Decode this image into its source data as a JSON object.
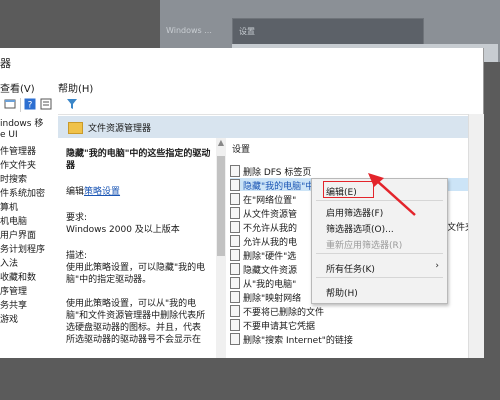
{
  "background_window": {
    "tree_item": "Windows ...",
    "header_text": "设置"
  },
  "window": {
    "title_partial": "器",
    "menu": {
      "view": "查看(V)",
      "help": "帮助(H)"
    }
  },
  "tree": [
    "indows 移",
    "e UI",
    "件管理器",
    "作文件夹",
    "时搜索",
    "件系统加密",
    "算机",
    "机电脑",
    "用户界面",
    "务计划程序",
    "入法",
    "收藏和数",
    "序管理",
    "务共享",
    "游戏"
  ],
  "header": {
    "title": "文件资源管理器"
  },
  "description": {
    "title_line1": "隐藏\"我的电脑\"中的这些指定的驱动",
    "title_line2": "器",
    "edit_prefix": "编辑",
    "edit_link": "策略设置",
    "req_label": "要求:",
    "req_value": "Windows 2000 及以上版本",
    "desc_label": "描述:",
    "desc_line1": "使用此策略设置，可以隐藏\"我的电",
    "desc_line2": "脑\"中的指定驱动器。",
    "desc_line3": "使用此策略设置，可以从\"我的电",
    "desc_line4": "脑\"和文件资源管理器中删除代表所",
    "desc_line5": "选硬盘驱动器的图标。并且，代表",
    "desc_line6": "所选驱动器的驱动器号不会显示在"
  },
  "list": {
    "column_header": "设置",
    "items": [
      "删除 DFS 标签页",
      "隐藏\"我的电脑\"中的这些指定的驱动器",
      "在\"网络位置\"",
      "从文件资源管",
      "不允许从我的",
      "允许从我的电",
      "删除\"硬件\"选",
      "隐藏文件资源",
      "从\"我的电脑\"",
      "删除\"映射网络",
      "不要将已删除的文件",
      "不要申请其它凭据",
      "删除\"搜索 Internet\"的链接"
    ],
    "right_overflow": "开文件夹"
  },
  "context_menu": {
    "items": [
      {
        "label": "编辑(E)",
        "disabled": false
      },
      {
        "label": "启用筛选器(F)",
        "disabled": false
      },
      {
        "label": "筛选器选项(O)...",
        "disabled": false
      },
      {
        "label": "重新应用筛选器(R)",
        "disabled": true
      },
      {
        "label": "所有任务(K)",
        "disabled": false,
        "submenu": true
      },
      {
        "label": "帮助(H)",
        "disabled": false
      }
    ]
  },
  "colors": {
    "highlight_box": "#e3242b",
    "selection": "#cce4f7",
    "header_band": "#d8e4ef"
  }
}
